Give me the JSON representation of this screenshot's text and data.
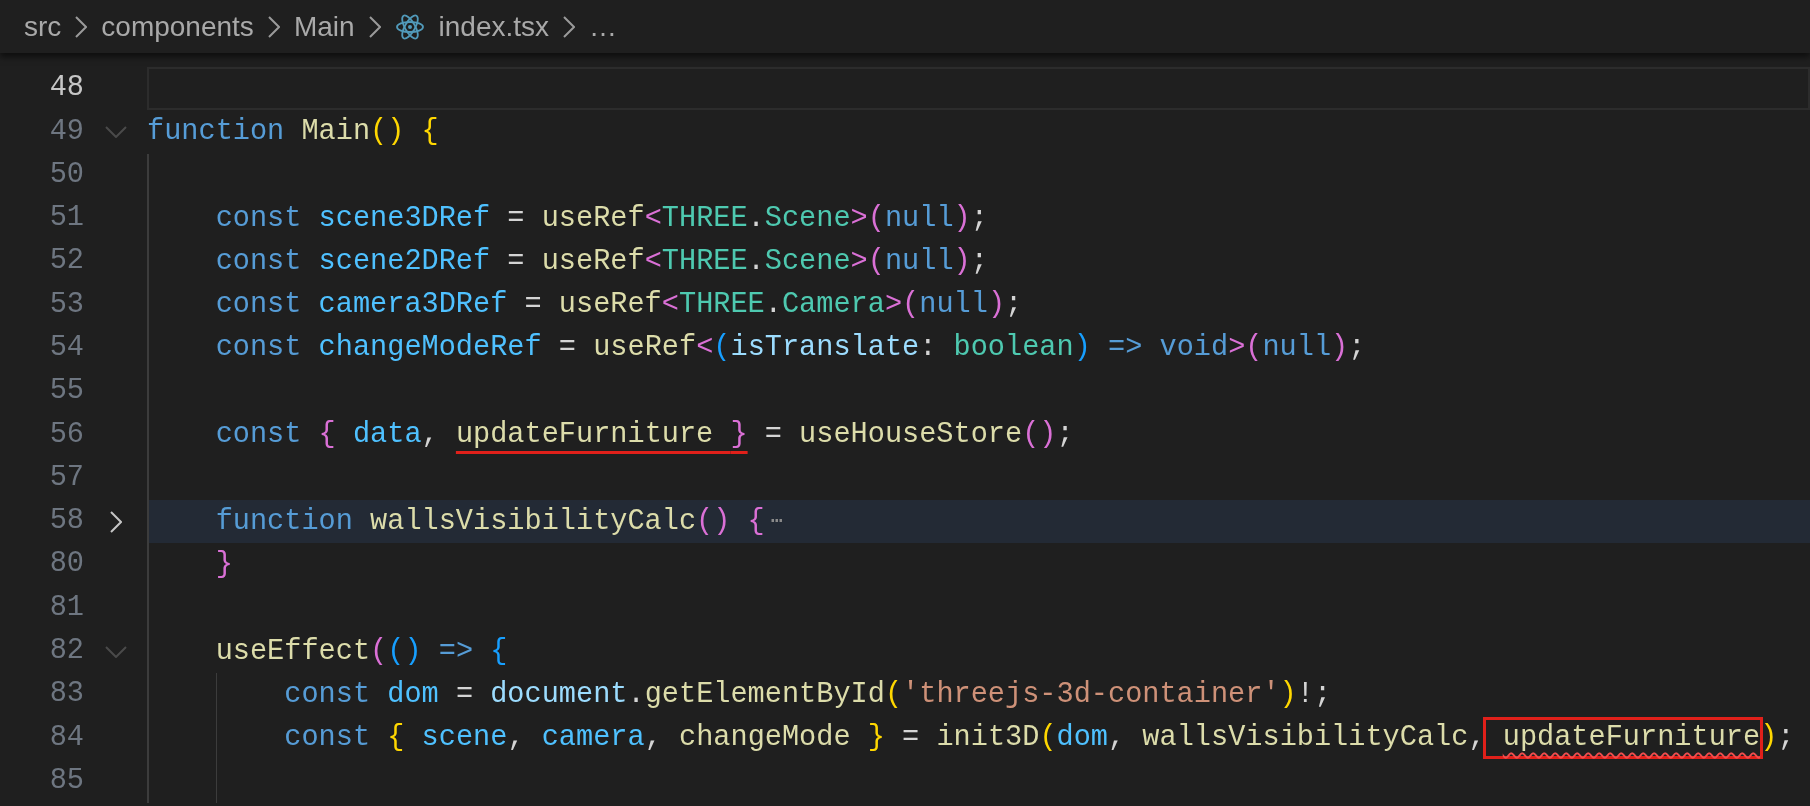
{
  "breadcrumb": [
    {
      "label": "src",
      "kind": "folder"
    },
    {
      "label": "components",
      "kind": "folder"
    },
    {
      "label": "Main",
      "kind": "folder"
    },
    {
      "label": "index.tsx",
      "kind": "file"
    },
    {
      "label": "…",
      "kind": "more"
    }
  ],
  "lines": [
    {
      "number": "48",
      "current": true
    },
    {
      "number": "49",
      "expanded": true,
      "tokens": [
        {
          "text": "function ",
          "kind": "kw"
        },
        {
          "text": "Main",
          "kind": "fn"
        },
        {
          "text": "()",
          "kind": "b1"
        },
        {
          "text": " {",
          "kind": "b1"
        }
      ]
    },
    {
      "number": "50"
    },
    {
      "number": "51",
      "tokens": [
        {
          "text": "    const ",
          "kind": "kw"
        },
        {
          "text": "scene3DRef",
          "kind": "var"
        },
        {
          "text": " = ",
          "kind": "op"
        },
        {
          "text": "useRef",
          "kind": "fn"
        },
        {
          "text": "<",
          "kind": "b2"
        },
        {
          "text": "THREE",
          "kind": "type"
        },
        {
          "text": ".",
          "kind": "op"
        },
        {
          "text": "Scene",
          "kind": "type"
        },
        {
          "text": ">(",
          "kind": "b2"
        },
        {
          "text": "null",
          "kind": "kw"
        },
        {
          "text": ")",
          "kind": "b2"
        },
        {
          "text": ";",
          "kind": "op"
        }
      ]
    },
    {
      "number": "52",
      "tokens": [
        {
          "text": "    const ",
          "kind": "kw"
        },
        {
          "text": "scene2DRef",
          "kind": "var"
        },
        {
          "text": " = ",
          "kind": "op"
        },
        {
          "text": "useRef",
          "kind": "fn"
        },
        {
          "text": "<",
          "kind": "b2"
        },
        {
          "text": "THREE",
          "kind": "type"
        },
        {
          "text": ".",
          "kind": "op"
        },
        {
          "text": "Scene",
          "kind": "type"
        },
        {
          "text": ">(",
          "kind": "b2"
        },
        {
          "text": "null",
          "kind": "kw"
        },
        {
          "text": ")",
          "kind": "b2"
        },
        {
          "text": ";",
          "kind": "op"
        }
      ]
    },
    {
      "number": "53",
      "tokens": [
        {
          "text": "    const ",
          "kind": "kw"
        },
        {
          "text": "camera3DRef",
          "kind": "var"
        },
        {
          "text": " = ",
          "kind": "op"
        },
        {
          "text": "useRef",
          "kind": "fn"
        },
        {
          "text": "<",
          "kind": "b2"
        },
        {
          "text": "THREE",
          "kind": "type"
        },
        {
          "text": ".",
          "kind": "op"
        },
        {
          "text": "Camera",
          "kind": "type"
        },
        {
          "text": ">(",
          "kind": "b2"
        },
        {
          "text": "null",
          "kind": "kw"
        },
        {
          "text": ")",
          "kind": "b2"
        },
        {
          "text": ";",
          "kind": "op"
        }
      ]
    },
    {
      "number": "54",
      "tokens": [
        {
          "text": "    const ",
          "kind": "kw"
        },
        {
          "text": "changeModeRef",
          "kind": "var"
        },
        {
          "text": " = ",
          "kind": "op"
        },
        {
          "text": "useRef",
          "kind": "fn"
        },
        {
          "text": "<",
          "kind": "b2"
        },
        {
          "text": "(",
          "kind": "b3"
        },
        {
          "text": "isTranslate",
          "kind": "prop"
        },
        {
          "text": ": ",
          "kind": "op"
        },
        {
          "text": "boolean",
          "kind": "type"
        },
        {
          "text": ")",
          "kind": "b3"
        },
        {
          "text": " => ",
          "kind": "kw"
        },
        {
          "text": "void",
          "kind": "kw"
        },
        {
          "text": ">(",
          "kind": "b2"
        },
        {
          "text": "null",
          "kind": "kw"
        },
        {
          "text": ")",
          "kind": "b2"
        },
        {
          "text": ";",
          "kind": "op"
        }
      ]
    },
    {
      "number": "55"
    },
    {
      "number": "56",
      "tokens": [
        {
          "text": "    const ",
          "kind": "kw"
        },
        {
          "text": "{",
          "kind": "b2"
        },
        {
          "text": " data",
          "kind": "var"
        },
        {
          "text": ", ",
          "kind": "op"
        },
        {
          "text": "updateFurniture ",
          "kind": "fn",
          "underlined": true
        },
        {
          "text": "}",
          "kind": "b2",
          "underlined": true
        },
        {
          "text": " = ",
          "kind": "op"
        },
        {
          "text": "useHouseStore",
          "kind": "fn"
        },
        {
          "text": "()",
          "kind": "b2"
        },
        {
          "text": ";",
          "kind": "op"
        }
      ]
    },
    {
      "number": "57"
    },
    {
      "number": "58",
      "expanded": false,
      "fold_marker": "⋯",
      "tokens": [
        {
          "text": "    function ",
          "kind": "kw"
        },
        {
          "text": "wallsVisibilityCalc",
          "kind": "fn"
        },
        {
          "text": "()",
          "kind": "b2"
        },
        {
          "text": " {",
          "kind": "b2"
        }
      ]
    },
    {
      "number": "80",
      "tokens": [
        {
          "text": "    }",
          "kind": "b2"
        }
      ]
    },
    {
      "number": "81"
    },
    {
      "number": "82",
      "expanded": true,
      "tokens": [
        {
          "text": "    useEffect",
          "kind": "fn"
        },
        {
          "text": "(",
          "kind": "b2"
        },
        {
          "text": "()",
          "kind": "b3"
        },
        {
          "text": " => ",
          "kind": "kw"
        },
        {
          "text": "{",
          "kind": "b3"
        }
      ]
    },
    {
      "number": "83",
      "tokens": [
        {
          "text": "        const ",
          "kind": "kw"
        },
        {
          "text": "dom",
          "kind": "var"
        },
        {
          "text": " = ",
          "kind": "op"
        },
        {
          "text": "document",
          "kind": "prop"
        },
        {
          "text": ".",
          "kind": "op"
        },
        {
          "text": "getElementById",
          "kind": "fn"
        },
        {
          "text": "(",
          "kind": "b1"
        },
        {
          "text": "'threejs-3d-container'",
          "kind": "str"
        },
        {
          "text": ")",
          "kind": "b1"
        },
        {
          "text": "!;",
          "kind": "op"
        }
      ]
    },
    {
      "number": "84",
      "tokens": [
        {
          "text": "        const ",
          "kind": "kw"
        },
        {
          "text": "{",
          "kind": "b1"
        },
        {
          "text": " scene",
          "kind": "var"
        },
        {
          "text": ", ",
          "kind": "op"
        },
        {
          "text": "camera",
          "kind": "var"
        },
        {
          "text": ", ",
          "kind": "op"
        },
        {
          "text": "changeMode",
          "kind": "fn"
        },
        {
          "text": " }",
          "kind": "b1"
        },
        {
          "text": " = ",
          "kind": "op"
        },
        {
          "text": "init3D",
          "kind": "fn"
        },
        {
          "text": "(",
          "kind": "b1"
        },
        {
          "text": "dom",
          "kind": "var"
        },
        {
          "text": ", ",
          "kind": "op"
        },
        {
          "text": "wallsVisibilityCalc",
          "kind": "fn"
        },
        {
          "text": ",",
          "kind": "op"
        },
        {
          "text": " updateFurniture",
          "kind": "fn",
          "boxed": true,
          "error": true
        },
        {
          "text": ")",
          "kind": "b1"
        },
        {
          "text": ";",
          "kind": "op"
        }
      ]
    },
    {
      "number": "85"
    }
  ]
}
